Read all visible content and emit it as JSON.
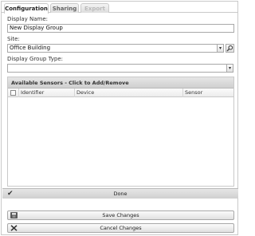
{
  "tabs": [
    {
      "label": "Configuration",
      "state": "active"
    },
    {
      "label": "Sharing",
      "state": "inactive"
    },
    {
      "label": "Export",
      "state": "disabled"
    }
  ],
  "form": {
    "display_name_label": "Display Name:",
    "display_name_value": "New Display Group",
    "site_label": "Site:",
    "site_value": "Office Building",
    "group_type_label": "Display Group Type:",
    "group_type_value": ""
  },
  "sensors_grid": {
    "title": "Available Sensors - Click to Add/Remove",
    "columns": [
      "Identifier",
      "Device",
      "Sensor"
    ],
    "rows": []
  },
  "done_label": "Done",
  "buttons": {
    "save_label": "Save Changes",
    "cancel_label": "Cancel Changes"
  },
  "icons": {
    "site_search": "search-icon",
    "done": "checkmark-icon",
    "save": "save-icon",
    "cancel": "close-icon"
  }
}
